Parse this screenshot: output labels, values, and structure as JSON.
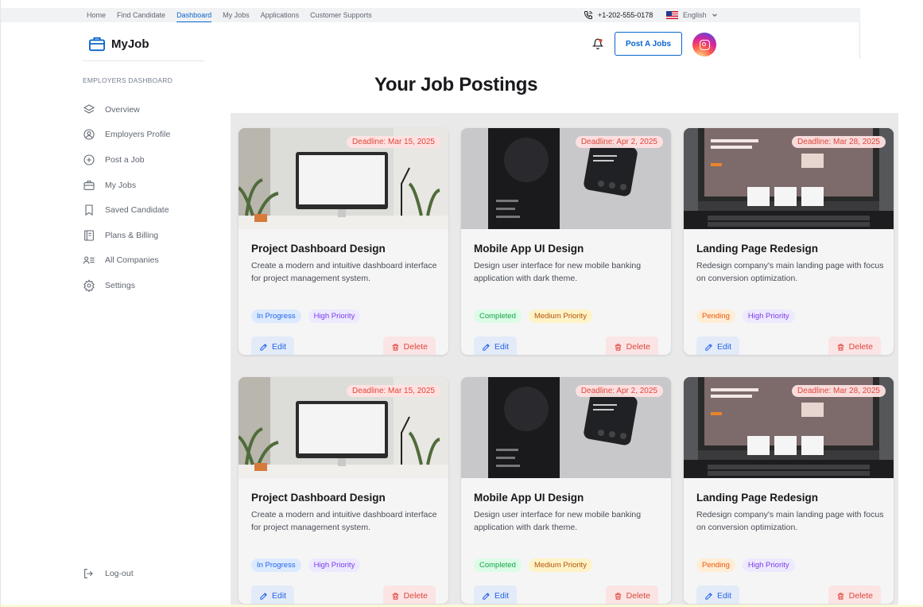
{
  "topnav": {
    "items": [
      "Home",
      "Find Candidate",
      "Dashboard",
      "My Jobs",
      "Applications",
      "Customer Supports"
    ],
    "active": "Dashboard",
    "phone": "+1-202-555-0178",
    "language": "English"
  },
  "header": {
    "brand": "MyJob",
    "post_button": "Post A Jobs"
  },
  "sidebar": {
    "section_title": "EMPLOYERS DASHBOARD",
    "items": [
      {
        "label": "Overview",
        "icon": "layers-icon"
      },
      {
        "label": "Employers Profile",
        "icon": "user-circle-icon"
      },
      {
        "label": "Post a Job",
        "icon": "plus-circle-icon"
      },
      {
        "label": "My Jobs",
        "icon": "briefcase-icon"
      },
      {
        "label": "Saved Candidate",
        "icon": "bookmark-icon"
      },
      {
        "label": "Plans & Billing",
        "icon": "receipt-icon"
      },
      {
        "label": "All Companies",
        "icon": "companies-icon"
      },
      {
        "label": "Settings",
        "icon": "gear-icon"
      }
    ],
    "logout": "Log-out"
  },
  "main": {
    "title": "Your Job Postings",
    "cards": [
      {
        "title": "Project Dashboard Design",
        "description": "Create a modern and intuitive dashboard interface for project management system.",
        "deadline": "Deadline: Mar 15, 2025",
        "status": "In Progress",
        "priority": "High Priority",
        "edit": "Edit",
        "delete": "Delete",
        "image": "desk-monitor"
      },
      {
        "title": "Mobile App UI Design",
        "description": "Design user interface for new mobile banking application with dark theme.",
        "deadline": "Deadline: Apr 2, 2025",
        "status": "Completed",
        "priority": "Medium Priority",
        "edit": "Edit",
        "delete": "Delete",
        "image": "mobile-phone"
      },
      {
        "title": "Landing Page Redesign",
        "description": "Redesign company's main landing page with focus on conversion optimization.",
        "deadline": "Deadline: Mar 28, 2025",
        "status": "Pending",
        "priority": "High Priority",
        "edit": "Edit",
        "delete": "Delete",
        "image": "laptop"
      },
      {
        "title": "Project Dashboard Design",
        "description": "Create a modern and intuitive dashboard interface for project management system.",
        "deadline": "Deadline: Mar 15, 2025",
        "status": "In Progress",
        "priority": "High Priority",
        "edit": "Edit",
        "delete": "Delete",
        "image": "desk-monitor"
      },
      {
        "title": "Mobile App UI Design",
        "description": "Design user interface for new mobile banking application with dark theme.",
        "deadline": "Deadline: Apr 2, 2025",
        "status": "Completed",
        "priority": "Medium Priority",
        "edit": "Edit",
        "delete": "Delete",
        "image": "mobile-phone"
      },
      {
        "title": "Landing Page Redesign",
        "description": "Redesign company's main landing page with focus on conversion optimization.",
        "deadline": "Deadline: Mar 28, 2025",
        "status": "Pending",
        "priority": "High Priority",
        "edit": "Edit",
        "delete": "Delete",
        "image": "laptop"
      }
    ]
  },
  "colors": {
    "accent": "#0a65cc",
    "delete": "#e0453a"
  }
}
